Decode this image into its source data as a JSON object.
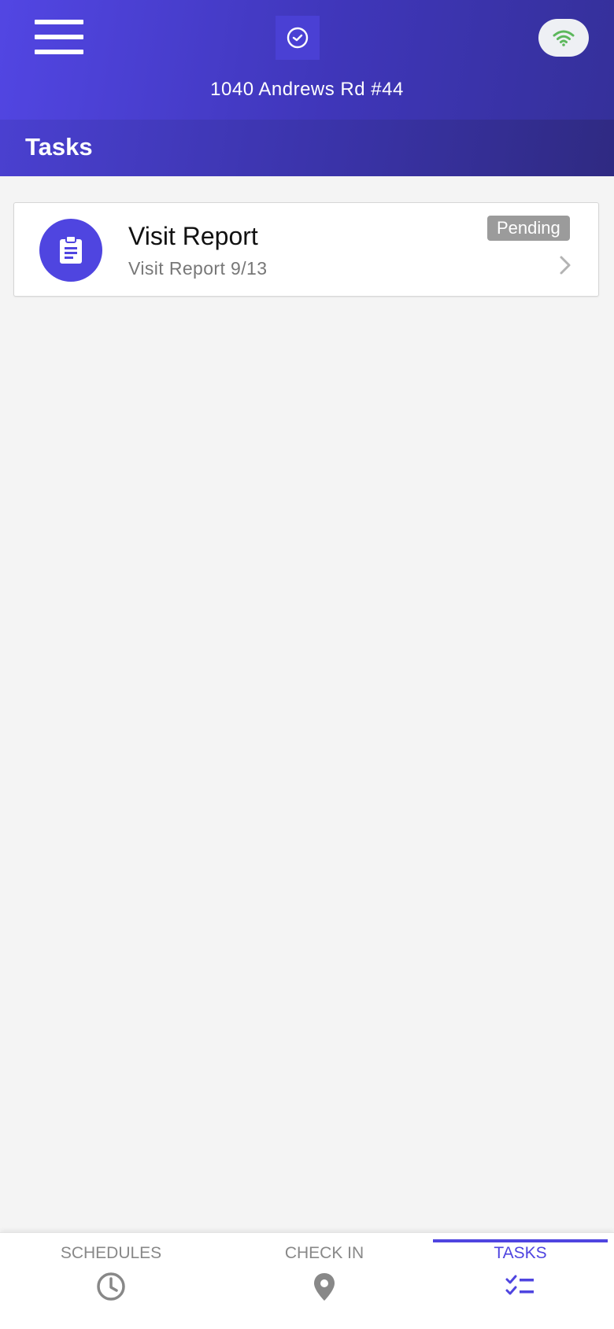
{
  "header": {
    "menu_icon": "hamburger-menu-icon",
    "logo_icon": "clock-check-icon",
    "connection_icon": "wifi-icon",
    "connection_color": "#5cb85c",
    "address": "1040 Andrews Rd #44"
  },
  "subbar": {
    "title": "Tasks"
  },
  "tasks": [
    {
      "icon": "clipboard-icon",
      "title": "Visit Report",
      "subtitle": "Visit Report 9/13",
      "status": "Pending"
    }
  ],
  "bottom_nav": {
    "items": [
      {
        "label": "SCHEDULES",
        "icon": "clock-icon",
        "active": false
      },
      {
        "label": "CHECK IN",
        "icon": "location-pin-icon",
        "active": false
      },
      {
        "label": "TASKS",
        "icon": "checklist-icon",
        "active": true
      }
    ]
  },
  "colors": {
    "accent": "#4f45e0",
    "header_start": "#5246e3",
    "header_end": "#35309a",
    "badge": "#9b9b9b"
  }
}
